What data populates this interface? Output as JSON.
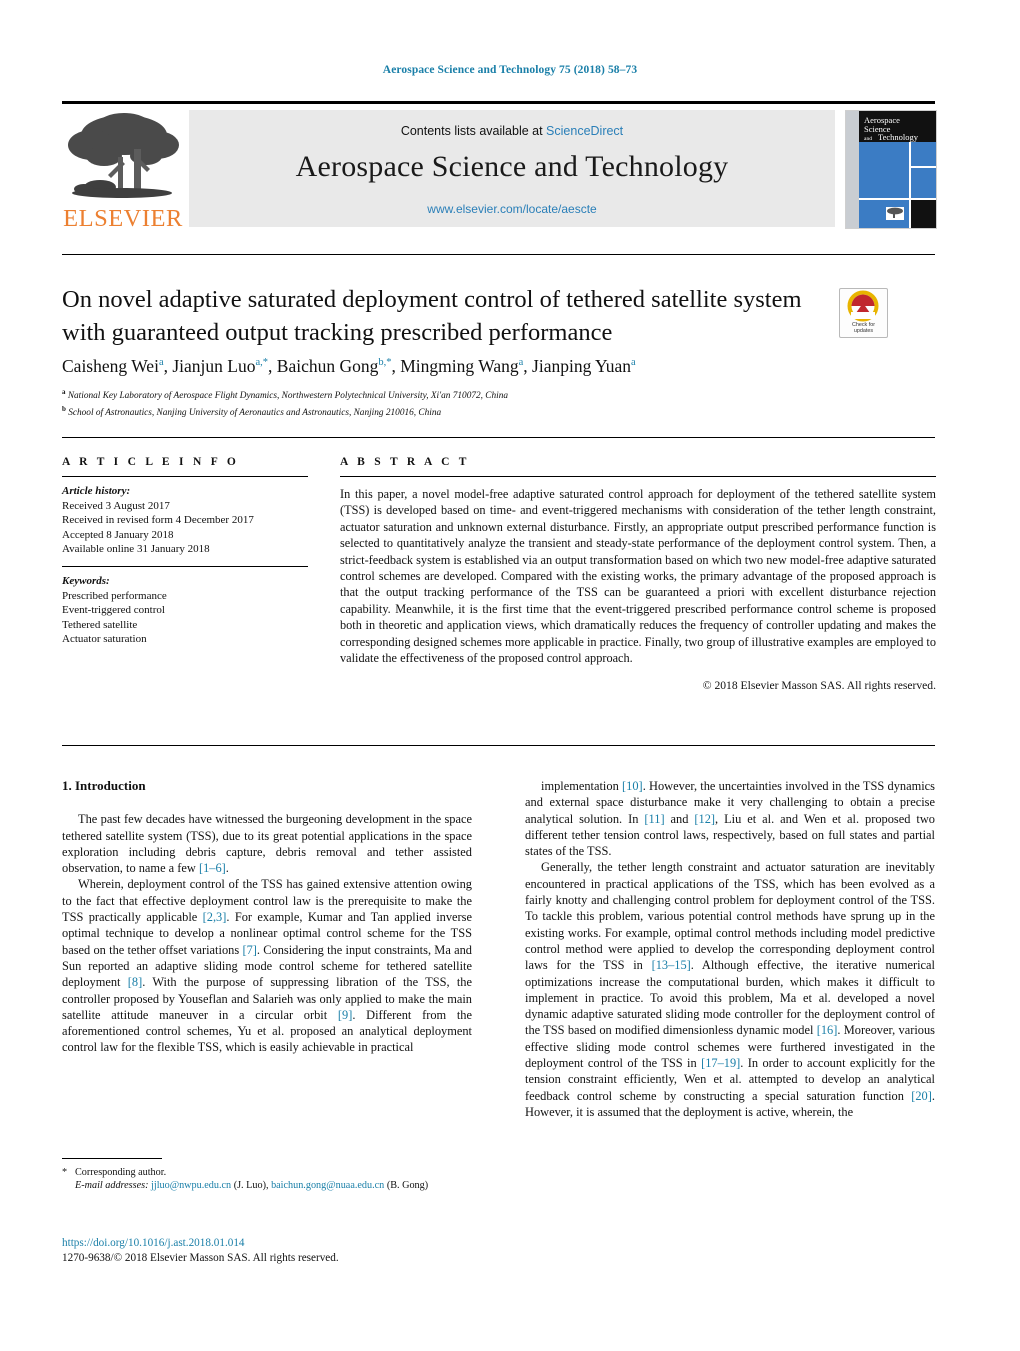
{
  "running_head": "Aerospace Science and Technology 75 (2018) 58–73",
  "masthead": {
    "contents_prefix": "Contents lists available at ",
    "sciencedirect": "ScienceDirect",
    "journal_title": "Aerospace Science and Technology",
    "journal_url": "www.elsevier.com/locate/aescte",
    "publisher_wordmark": "ELSEVIER",
    "cover_title_line1": "Aerospace",
    "cover_title_line2": "Science",
    "cover_title_line3": "and",
    "cover_title_line4": "Technology"
  },
  "article": {
    "title": "On novel adaptive saturated deployment control of tethered satellite system with guaranteed output tracking prescribed performance",
    "crossmark_label_line1": "Check for",
    "crossmark_label_line2": "updates",
    "authors_html": "Caisheng Wei<sup>a</sup>, Jianjun Luo<sup>a,*</sup>, Baichun Gong<sup>b,*</sup>, Mingming Wang<sup>a</sup>, Jianping Yuan<sup>a</sup>",
    "affiliations": [
      {
        "marker": "a",
        "text": "National Key Laboratory of Aerospace Flight Dynamics, Northwestern Polytechnical University, Xi'an 710072, China"
      },
      {
        "marker": "b",
        "text": "School of Astronautics, Nanjing University of Aeronautics and Astronautics, Nanjing 210016, China"
      }
    ]
  },
  "info": {
    "heading": "A R T I C L E   I N F O",
    "history_label": "Article history:",
    "history": [
      "Received 3 August 2017",
      "Received in revised form 4 December 2017",
      "Accepted 8 January 2018",
      "Available online 31 January 2018"
    ],
    "keywords_label": "Keywords:",
    "keywords": [
      "Prescribed performance",
      "Event-triggered control",
      "Tethered satellite",
      "Actuator saturation"
    ]
  },
  "abstract": {
    "heading": "A B S T R A C T",
    "text": "In this paper, a novel model-free adaptive saturated control approach for deployment of the tethered satellite system (TSS) is developed based on time- and event-triggered mechanisms with consideration of the tether length constraint, actuator saturation and unknown external disturbance. Firstly, an appropriate output prescribed performance function is selected to quantitatively analyze the transient and steady-state performance of the deployment control system. Then, a strict-feedback system is established via an output transformation based on which two new model-free adaptive saturated control schemes are developed. Compared with the existing works, the primary advantage of the proposed approach is that the output tracking performance of the TSS can be guaranteed a priori with excellent disturbance rejection capability. Meanwhile, it is the first time that the event-triggered prescribed performance control scheme is proposed both in theoretic and application views, which dramatically reduces the frequency of controller updating and makes the corresponding designed schemes more applicable in practice. Finally, two group of illustrative examples are employed to validate the effectiveness of the proposed control approach.",
    "copyright": "© 2018 Elsevier Masson SAS. All rights reserved."
  },
  "body": {
    "section_number_title": "1. Introduction",
    "left_paragraphs_html": [
      "The past few decades have witnessed the burgeoning development in the space tethered satellite system (TSS), due to its great potential applications in the space exploration including debris capture, debris removal and tether assisted observation, to name a few <span class=\"cite\">[1–6]</span>.",
      "Wherein, deployment control of the TSS has gained extensive attention owing to the fact that effective deployment control law is the prerequisite to make the TSS practically applicable <span class=\"cite\">[2,3]</span>. For example, Kumar and Tan applied inverse optimal technique to develop a nonlinear optimal control scheme for the TSS based on the tether offset variations <span class=\"cite\">[7]</span>. Considering the input constraints, Ma and Sun reported an adaptive sliding mode control scheme for tethered satellite deployment <span class=\"cite\">[8]</span>. With the purpose of suppressing libration of the TSS, the controller proposed by Youseflan and Salarieh was only applied to make the main satellite attitude maneuver in a circular orbit <span class=\"cite\">[9]</span>. Different from the aforementioned control schemes, Yu et al. proposed an analytical deployment control law for the flexible TSS, which is easily achievable in practical"
    ],
    "right_paragraphs_html": [
      "implementation <span class=\"cite\">[10]</span>. However, the uncertainties involved in the TSS dynamics and external space disturbance make it very challenging to obtain a precise analytical solution. In <span class=\"cite\">[11]</span> and <span class=\"cite\">[12]</span>, Liu et al. and Wen et al. proposed two different tether tension control laws, respectively, based on full states and partial states of the TSS.",
      "Generally, the tether length constraint and actuator saturation are inevitably encountered in practical applications of the TSS, which has been evolved as a fairly knotty and challenging control problem for deployment control of the TSS. To tackle this problem, various potential control methods have sprung up in the existing works. For example, optimal control methods including model predictive control method were applied to develop the corresponding deployment control laws for the TSS in <span class=\"cite\">[13–15]</span>. Although effective, the iterative numerical optimizations increase the computational burden, which makes it difficult to implement in practice. To avoid this problem, Ma et al. developed a novel dynamic adaptive saturated sliding mode controller for the deployment control of the TSS based on modified dimensionless dynamic model <span class=\"cite\">[16]</span>. Moreover, various effective sliding mode control schemes were furthered investigated in the deployment control of the TSS in <span class=\"cite\">[17–19]</span>. In order to account explicitly for the tension constraint efficiently, Wen et al. attempted to develop an analytical feedback control scheme by constructing a special saturation function <span class=\"cite\">[20]</span>. However, it is assumed that the deployment is active, wherein, the"
    ]
  },
  "footnote": {
    "corresponding_author": "Corresponding author.",
    "email_label": "E-mail addresses:",
    "emails": [
      {
        "address": "jjluo@nwpu.edu.cn",
        "person": "(J. Luo)"
      },
      {
        "address": "baichun.gong@nuaa.edu.cn",
        "person": "(B. Gong)"
      }
    ],
    "doi": "https://doi.org/10.1016/j.ast.2018.01.014",
    "issn_line": "1270-9638/© 2018 Elsevier Masson SAS. All rights reserved."
  },
  "colors": {
    "link": "#1a7fa8",
    "elsevier_orange": "#ec8031",
    "cover_blue": "#3b7cc4",
    "masthead_grey": "#e9e9e9"
  }
}
